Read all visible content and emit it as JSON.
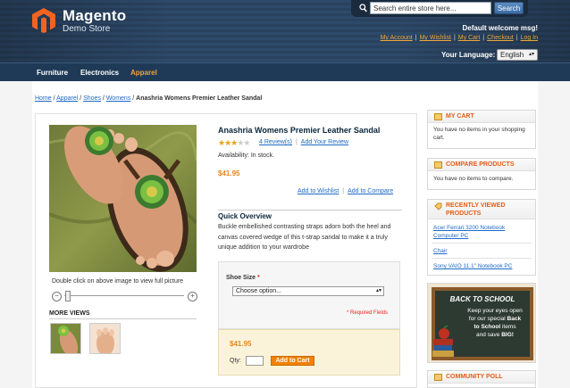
{
  "header": {
    "logo_title": "Magento",
    "logo_subtitle": "Demo Store",
    "search_placeholder": "Search entire store here...",
    "search_button": "Search",
    "welcome": "Default welcome msg!",
    "links": [
      "My Account",
      "My Wishlist",
      "My Cart",
      "Checkout",
      "Log In"
    ],
    "language_label": "Your Language:",
    "language_value": "English"
  },
  "nav": {
    "items": [
      "Furniture",
      "Electronics",
      "Apparel"
    ],
    "active": "Apparel"
  },
  "breadcrumb": {
    "links": [
      "Home",
      "Apparel",
      "Shoes",
      "Womens"
    ],
    "current": "Anashria Womens Premier Leather Sandal"
  },
  "product": {
    "name": "Anashria Womens Premier Leather Sandal",
    "rating_stars": 3,
    "rating_max": 5,
    "reviews_link": "4 Review(s)",
    "add_review_link": "Add Your Review",
    "availability": "Availability: In stock.",
    "price": "$41.95",
    "wishlist_link": "Add to Wishlist",
    "compare_link": "Add to Compare",
    "image_caption": "Double click on above image to view full picture",
    "more_views": "MORE VIEWS",
    "quick_overview_title": "Quick Overview",
    "quick_overview_text": "Buckle embellished contrasting straps adorn both the heel and canvas covered wedge of this t-strap sandal to make it a truly unique addition to your wardrobe",
    "option_label": "Shoe Size",
    "option_required_mark": "*",
    "option_select_value": "Choose option...",
    "required_fields": "* Required Fields",
    "cart_price": "$41.95",
    "qty_label": "Qty:",
    "qty_value": "",
    "add_to_cart": "Add to Cart"
  },
  "sidebar": {
    "my_cart": {
      "title": "MY CART",
      "text": "You have no items in your shopping cart."
    },
    "compare": {
      "title": "COMPARE PRODUCTS",
      "text": "You have no items to compare."
    },
    "recently_viewed": {
      "title": "RECENTLY VIEWED PRODUCTS",
      "items": [
        "Acer Ferrari 3200 Notebook Computer PC",
        "Chair",
        "Sony VAIO 11.1\" Notebook PC"
      ]
    },
    "back_to_school": {
      "title": "BACK TO SCHOOL",
      "line1": "Keep your eyes open",
      "line2a": "for our special",
      "line2b": "Back",
      "line3a": "to School",
      "line3b": "items",
      "line4a": "and save",
      "line4b": "BIG!"
    },
    "poll": {
      "title": "COMMUNITY POLL"
    }
  },
  "colors": {
    "accent_orange": "#f18200",
    "link_blue": "#1e6ac6",
    "header_blue": "#2e4a6a",
    "sidebar_title": "#e25d16"
  }
}
